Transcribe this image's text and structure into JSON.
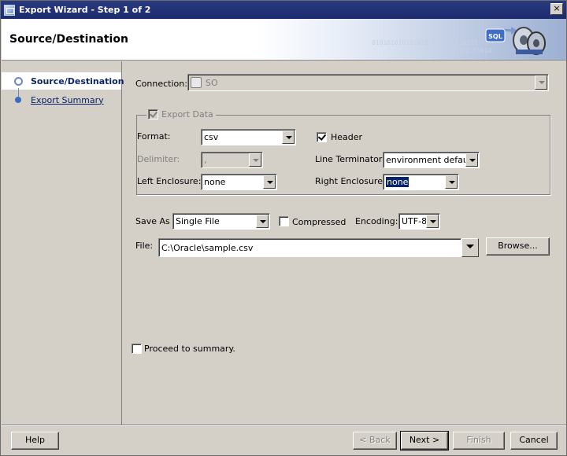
{
  "window": {
    "title": "Export Wizard - Step 1 of 2",
    "close_glyph": "×"
  },
  "header": {
    "title": "Source/Destination",
    "binary_1": "0101010101010101010101010101",
    "binary_2": "0101010101010",
    "logo_text": "SQL"
  },
  "nav": {
    "items": [
      {
        "label": "Source/Destination",
        "active": true
      },
      {
        "label": "Export Summary",
        "active": false
      }
    ]
  },
  "form": {
    "connection_label": "Connection:",
    "connection_value": "SO",
    "export_data_label": "Export Data",
    "format_label": "Format:",
    "format_value": "csv",
    "header_label": "Header",
    "delimiter_label": "Delimiter:",
    "delimiter_value": ",",
    "line_terminator_label": "Line Terminator:",
    "line_terminator_value": "environment default",
    "left_enclosure_label": "Left Enclosure:",
    "left_enclosure_value": "none",
    "right_enclosure_label": "Right Enclosure:",
    "right_enclosure_value": "none",
    "save_as_label": "Save As",
    "save_as_value": "Single File",
    "compressed_label": "Compressed",
    "encoding_label": "Encoding:",
    "encoding_value": "UTF-8",
    "file_label": "File:",
    "file_value": "C:\\Oracle\\sample.csv",
    "browse_label": "Browse...",
    "proceed_label": "Proceed to summary."
  },
  "footer": {
    "help_label": "Help",
    "back_label": "< Back",
    "next_label": "Next >",
    "finish_label": "Finish",
    "cancel_label": "Cancel"
  },
  "colors": {
    "titlebar": "#1d2b6e",
    "selection": "#0a246a",
    "dialog_bg": "#d4d0c8"
  }
}
